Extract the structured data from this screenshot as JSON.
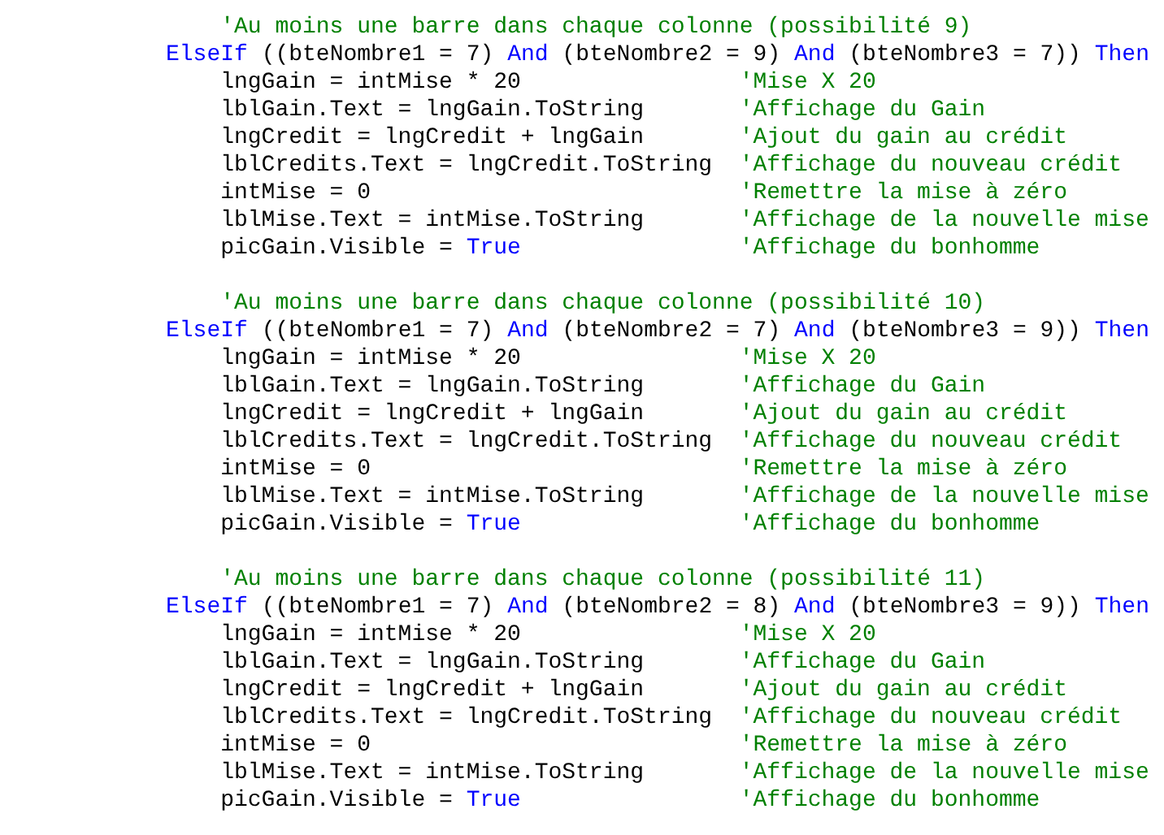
{
  "code_blocks": [
    {
      "comment": "'Au moins une barre dans chaque colonne (possibilité 9)",
      "condition": [
        {
          "kind": "keyword",
          "text": "ElseIf"
        },
        {
          "kind": "code",
          "text": " ((bteNombre1 = 7) "
        },
        {
          "kind": "keyword",
          "text": "And"
        },
        {
          "kind": "code",
          "text": " (bteNombre2 = 9) "
        },
        {
          "kind": "keyword",
          "text": "And"
        },
        {
          "kind": "code",
          "text": " (bteNombre3 = 7)) "
        },
        {
          "kind": "keyword",
          "text": "Then"
        }
      ],
      "statements": [
        {
          "code": [
            {
              "kind": "code",
              "text": "lngGain = intMise * 20"
            }
          ],
          "comment": "'Mise X 20"
        },
        {
          "code": [
            {
              "kind": "code",
              "text": "lblGain.Text = lngGain.ToString"
            }
          ],
          "comment": "'Affichage du Gain"
        },
        {
          "code": [
            {
              "kind": "code",
              "text": "lngCredit = lngCredit + lngGain"
            }
          ],
          "comment": "'Ajout du gain au crédit"
        },
        {
          "code": [
            {
              "kind": "code",
              "text": "lblCredits.Text = lngCredit.ToString"
            }
          ],
          "comment": "'Affichage du nouveau crédit"
        },
        {
          "code": [
            {
              "kind": "code",
              "text": "intMise = 0"
            }
          ],
          "comment": "'Remettre la mise à zéro"
        },
        {
          "code": [
            {
              "kind": "code",
              "text": "lblMise.Text = intMise.ToString"
            }
          ],
          "comment": "'Affichage de la nouvelle mise"
        },
        {
          "code": [
            {
              "kind": "code",
              "text": "picGain.Visible = "
            },
            {
              "kind": "keyword",
              "text": "True"
            }
          ],
          "comment": "'Affichage du bonhomme"
        }
      ]
    },
    {
      "comment": "'Au moins une barre dans chaque colonne (possibilité 10)",
      "condition": [
        {
          "kind": "keyword",
          "text": "ElseIf"
        },
        {
          "kind": "code",
          "text": " ((bteNombre1 = 7) "
        },
        {
          "kind": "keyword",
          "text": "And"
        },
        {
          "kind": "code",
          "text": " (bteNombre2 = 7) "
        },
        {
          "kind": "keyword",
          "text": "And"
        },
        {
          "kind": "code",
          "text": " (bteNombre3 = 9)) "
        },
        {
          "kind": "keyword",
          "text": "Then"
        }
      ],
      "statements": [
        {
          "code": [
            {
              "kind": "code",
              "text": "lngGain = intMise * 20"
            }
          ],
          "comment": "'Mise X 20"
        },
        {
          "code": [
            {
              "kind": "code",
              "text": "lblGain.Text = lngGain.ToString"
            }
          ],
          "comment": "'Affichage du Gain"
        },
        {
          "code": [
            {
              "kind": "code",
              "text": "lngCredit = lngCredit + lngGain"
            }
          ],
          "comment": "'Ajout du gain au crédit"
        },
        {
          "code": [
            {
              "kind": "code",
              "text": "lblCredits.Text = lngCredit.ToString"
            }
          ],
          "comment": "'Affichage du nouveau crédit"
        },
        {
          "code": [
            {
              "kind": "code",
              "text": "intMise = 0"
            }
          ],
          "comment": "'Remettre la mise à zéro"
        },
        {
          "code": [
            {
              "kind": "code",
              "text": "lblMise.Text = intMise.ToString"
            }
          ],
          "comment": "'Affichage de la nouvelle mise"
        },
        {
          "code": [
            {
              "kind": "code",
              "text": "picGain.Visible = "
            },
            {
              "kind": "keyword",
              "text": "True"
            }
          ],
          "comment": "'Affichage du bonhomme"
        }
      ]
    },
    {
      "comment": "'Au moins une barre dans chaque colonne (possibilité 11)",
      "condition": [
        {
          "kind": "keyword",
          "text": "ElseIf"
        },
        {
          "kind": "code",
          "text": " ((bteNombre1 = 7) "
        },
        {
          "kind": "keyword",
          "text": "And"
        },
        {
          "kind": "code",
          "text": " (bteNombre2 = 8) "
        },
        {
          "kind": "keyword",
          "text": "And"
        },
        {
          "kind": "code",
          "text": " (bteNombre3 = 9)) "
        },
        {
          "kind": "keyword",
          "text": "Then"
        }
      ],
      "statements": [
        {
          "code": [
            {
              "kind": "code",
              "text": "lngGain = intMise * 20"
            }
          ],
          "comment": "'Mise X 20"
        },
        {
          "code": [
            {
              "kind": "code",
              "text": "lblGain.Text = lngGain.ToString"
            }
          ],
          "comment": "'Affichage du Gain"
        },
        {
          "code": [
            {
              "kind": "code",
              "text": "lngCredit = lngCredit + lngGain"
            }
          ],
          "comment": "'Ajout du gain au crédit"
        },
        {
          "code": [
            {
              "kind": "code",
              "text": "lblCredits.Text = lngCredit.ToString"
            }
          ],
          "comment": "'Affichage du nouveau crédit"
        },
        {
          "code": [
            {
              "kind": "code",
              "text": "intMise = 0"
            }
          ],
          "comment": "'Remettre la mise à zéro"
        },
        {
          "code": [
            {
              "kind": "code",
              "text": "lblMise.Text = intMise.ToString"
            }
          ],
          "comment": "'Affichage de la nouvelle mise"
        },
        {
          "code": [
            {
              "kind": "code",
              "text": "picGain.Visible = "
            },
            {
              "kind": "keyword",
              "text": "True"
            }
          ],
          "comment": "'Affichage du bonhomme"
        }
      ]
    }
  ]
}
